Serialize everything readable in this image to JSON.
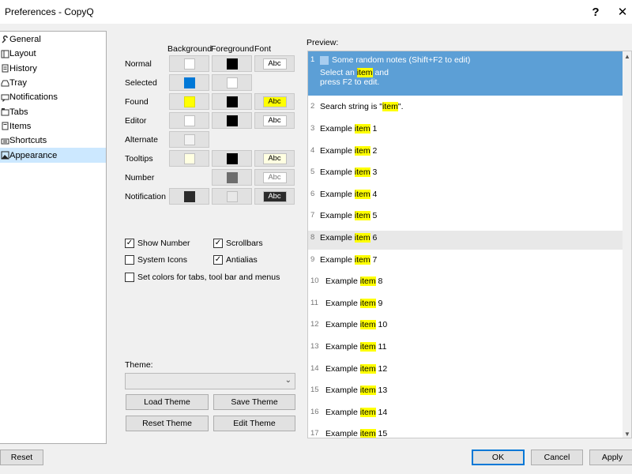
{
  "window": {
    "title": "Preferences - CopyQ",
    "help": "?",
    "close": "✕"
  },
  "sidebar": {
    "items": [
      {
        "label": "General",
        "icon": "wrench-icon"
      },
      {
        "label": "Layout",
        "icon": "layout-icon"
      },
      {
        "label": "History",
        "icon": "history-icon"
      },
      {
        "label": "Tray",
        "icon": "tray-icon"
      },
      {
        "label": "Notifications",
        "icon": "notifications-icon"
      },
      {
        "label": "Tabs",
        "icon": "tabs-icon"
      },
      {
        "label": "Items",
        "icon": "items-icon"
      },
      {
        "label": "Shortcuts",
        "icon": "shortcuts-icon"
      },
      {
        "label": "Appearance",
        "icon": "appearance-icon",
        "selected": true
      }
    ]
  },
  "colors": {
    "headers": {
      "background": "Background",
      "foreground": "Foreground",
      "font": "Font"
    },
    "rows": [
      {
        "label": "Normal",
        "bg": "#ffffff",
        "fg": "#000000",
        "font": "Abc",
        "font_bg": "#ffffff",
        "font_fg": "#000000"
      },
      {
        "label": "Selected",
        "bg": "#0078d7",
        "fg": "#ffffff"
      },
      {
        "label": "Found",
        "bg": "#ffff00",
        "fg": "#000000",
        "font": "Abc",
        "font_bg": "#ffff00",
        "font_fg": "#000000"
      },
      {
        "label": "Editor",
        "bg": "#ffffff",
        "fg": "#000000",
        "font": "Abc",
        "font_bg": "#ffffff",
        "font_fg": "#000000"
      },
      {
        "label": "Alternate",
        "bg": "#f3f3f3"
      },
      {
        "label": "Tooltips",
        "bg": "#ffffe1",
        "fg": "#000000",
        "font": "Abc",
        "font_bg": "#ffffe1",
        "font_fg": "#000000"
      },
      {
        "label": "Number",
        "fg": "#6d6d6d",
        "font": "Abc",
        "font_bg": "#ffffff",
        "font_fg": "#777777"
      },
      {
        "label": "Notification",
        "bg": "#2b2b2b",
        "fg": "#e8e8e8",
        "font": "Abc",
        "font_bg": "#2b2b2b",
        "font_fg": "#ffffff"
      }
    ]
  },
  "options": {
    "show_number": {
      "label": "Show Number",
      "checked": true
    },
    "scrollbars": {
      "label": "Scrollbars",
      "checked": true
    },
    "system_icons": {
      "label": "System Icons",
      "checked": false
    },
    "antialias": {
      "label": "Antialias",
      "checked": true
    },
    "set_colors": {
      "label": "Set colors for tabs, tool bar and menus",
      "checked": false
    }
  },
  "theme": {
    "label": "Theme:",
    "selected": "",
    "load": "Load Theme",
    "save": "Save Theme",
    "reset": "Reset Theme",
    "edit": "Edit Theme"
  },
  "preview": {
    "label": "Preview:",
    "item1_title": "Some random notes (Shift+F2 to edit)",
    "item1_line2_pre": "Select an ",
    "item1_line2_hl": "item",
    "item1_line2_post": " and",
    "item1_line3": "press F2 to edit.",
    "item2_pre": "Search string is \"",
    "item2_hl": "item",
    "item2_post": "\".",
    "examples": [
      {
        "n": "3",
        "pre": "Example ",
        "hl": "item",
        "post": " 1"
      },
      {
        "n": "4",
        "pre": "Example ",
        "hl": "item",
        "post": " 2"
      },
      {
        "n": "5",
        "pre": "Example ",
        "hl": "item",
        "post": " 3"
      },
      {
        "n": "6",
        "pre": "Example ",
        "hl": "item",
        "post": " 4"
      },
      {
        "n": "7",
        "pre": "Example ",
        "hl": "item",
        "post": " 5"
      },
      {
        "n": "8",
        "pre": "Example ",
        "hl": "item",
        "post": " 6"
      },
      {
        "n": "9",
        "pre": "Example ",
        "hl": "item",
        "post": " 7"
      },
      {
        "n": "10",
        "pre": "Example ",
        "hl": "item",
        "post": " 8"
      },
      {
        "n": "11",
        "pre": "Example ",
        "hl": "item",
        "post": " 9"
      },
      {
        "n": "12",
        "pre": "Example ",
        "hl": "item",
        "post": " 10"
      },
      {
        "n": "13",
        "pre": "Example ",
        "hl": "item",
        "post": " 11"
      },
      {
        "n": "14",
        "pre": "Example ",
        "hl": "item",
        "post": " 12"
      },
      {
        "n": "15",
        "pre": "Example ",
        "hl": "item",
        "post": " 13"
      },
      {
        "n": "16",
        "pre": "Example ",
        "hl": "item",
        "post": " 14"
      },
      {
        "n": "17",
        "pre": "Example ",
        "hl": "item",
        "post": " 15"
      }
    ]
  },
  "footer": {
    "reset": "Reset",
    "ok": "OK",
    "cancel": "Cancel",
    "apply": "Apply"
  },
  "accent": "#0078d7",
  "highlight": "#ffff00"
}
